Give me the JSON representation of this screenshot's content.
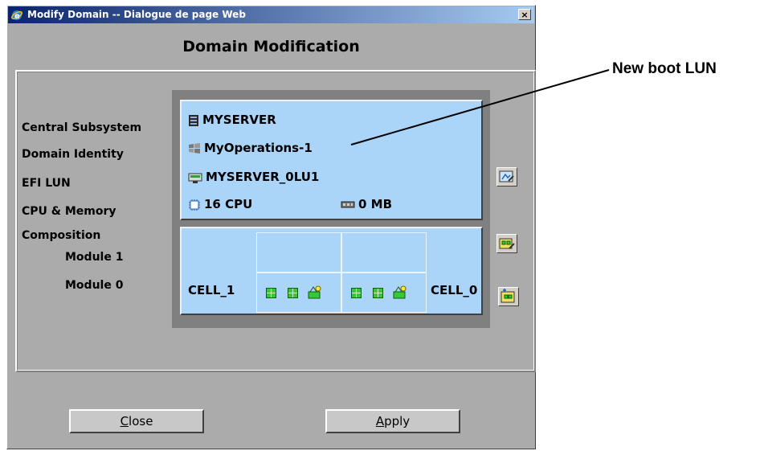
{
  "window": {
    "title": "Modify Domain -- Dialogue de page Web",
    "close_glyph": "×"
  },
  "dialog": {
    "heading": "Domain Modification",
    "labels": {
      "central_subsystem": "Central Subsystem",
      "domain_identity": "Domain Identity",
      "efi_lun": "EFI LUN",
      "cpu_memory": "CPU & Memory",
      "composition": "Composition",
      "module_1": "Module 1",
      "module_0": "Module 0"
    },
    "values": {
      "server": "MYSERVER",
      "identity": "MyOperations-1",
      "lun": "MYSERVER_0LU1",
      "cpu": "16 CPU",
      "memory": "0 MB"
    },
    "composition": {
      "left_cell": "CELL_1",
      "right_cell": "CELL_0"
    },
    "buttons": {
      "close_access": "C",
      "close_rest": "lose",
      "apply_access": "A",
      "apply_rest": "pply"
    }
  },
  "annotation": {
    "text": "New boot LUN"
  },
  "colors": {
    "titlebar_start": "#0a246a",
    "titlebar_end": "#a6caf0",
    "panel_fill": "#aad4f8",
    "dialog_bg": "#ababab"
  }
}
